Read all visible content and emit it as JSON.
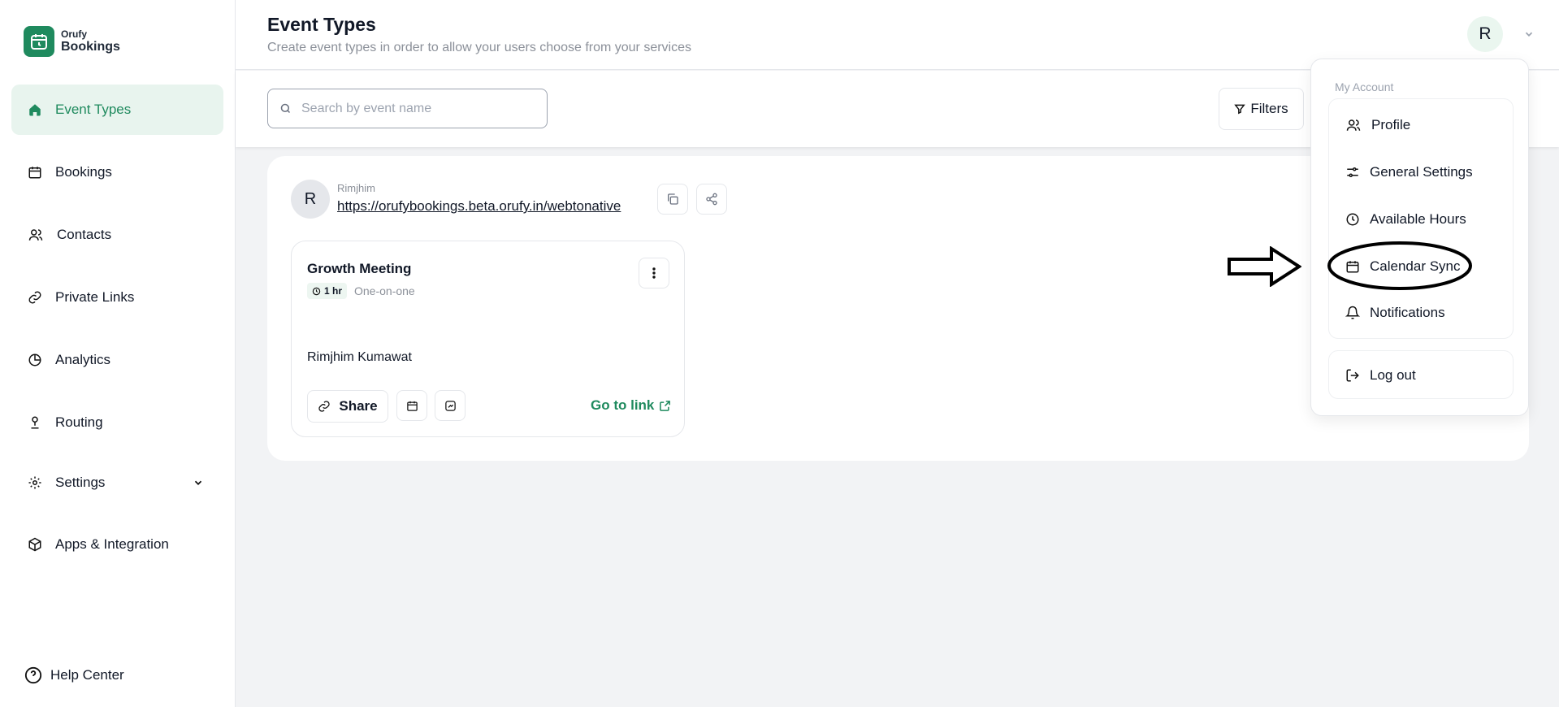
{
  "brand": {
    "small": "Orufy",
    "big": "Bookings",
    "accent": "#1f8a5e"
  },
  "sidebar": {
    "items": [
      {
        "label": "Event Types",
        "icon": "home-icon",
        "active": true
      },
      {
        "label": "Bookings",
        "icon": "calendar-icon"
      },
      {
        "label": "Contacts",
        "icon": "users-icon"
      },
      {
        "label": "Private Links",
        "icon": "link-icon"
      },
      {
        "label": "Analytics",
        "icon": "pie-chart-icon"
      },
      {
        "label": "Routing",
        "icon": "route-icon"
      },
      {
        "label": "Settings",
        "icon": "gear-icon"
      },
      {
        "label": "Apps & Integration",
        "icon": "package-icon"
      }
    ],
    "help": "Help Center"
  },
  "header": {
    "title": "Event Types",
    "subtitle": "Create event types in order to allow your users choose from your services",
    "avatar_initial": "R"
  },
  "toolbar": {
    "search_placeholder": "Search by event name",
    "filters_label": "Filters"
  },
  "owner": {
    "initial": "R",
    "name": "Rimjhim",
    "link": "https://orufybookings.beta.orufy.in/webtonative"
  },
  "event_card": {
    "title": "Growth Meeting",
    "duration": "1 hr",
    "kind": "One-on-one",
    "host": "Rimjhim Kumawat",
    "share_label": "Share",
    "goto_label": "Go to link"
  },
  "account_menu": {
    "heading": "My Account",
    "items": [
      {
        "label": "Profile",
        "icon": "users-icon"
      },
      {
        "label": "General Settings",
        "icon": "sliders-icon"
      },
      {
        "label": "Available Hours",
        "icon": "clock-icon"
      },
      {
        "label": "Calendar Sync",
        "icon": "calendar-icon"
      },
      {
        "label": "Notifications",
        "icon": "bell-icon"
      }
    ],
    "logout": "Log out"
  }
}
